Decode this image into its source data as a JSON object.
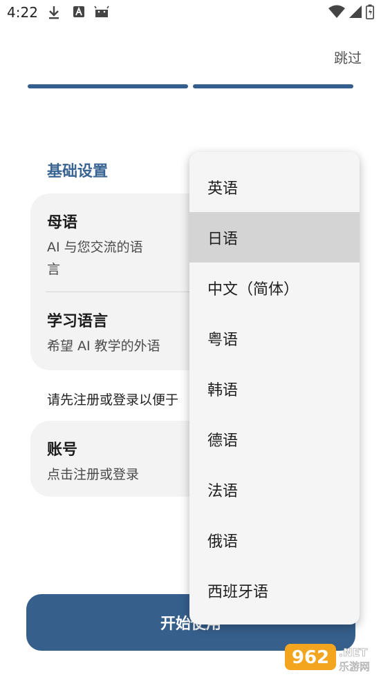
{
  "status_bar": {
    "time": "4:22"
  },
  "header": {
    "skip": "跳过"
  },
  "settings": {
    "section_title": "基础设置",
    "native_language": {
      "title": "母语",
      "subtitle_line1": "AI 与您交流的语",
      "subtitle_line2": "言"
    },
    "study_language": {
      "title": "学习语言",
      "subtitle": "希望 AI 教学的外语"
    },
    "notice": "请先注册或登录以便于",
    "account": {
      "title": "账号",
      "subtitle": "点击注册或登录"
    }
  },
  "start_button": {
    "label": "开始使用"
  },
  "menu": {
    "items": [
      "英语",
      "日语",
      "中文（简体）",
      "粤语",
      "韩语",
      "德语",
      "法语",
      "俄语",
      "西班牙语"
    ],
    "selected": "日语"
  },
  "watermark": {
    "text1": "962",
    "text2": ".NET",
    "text3": "乐游网"
  },
  "colors": {
    "accent": "#365f8c",
    "section_title": "#3a6592",
    "card_bg": "#f3f3f3",
    "menu_bg": "#f5f5f5",
    "menu_selected_bg": "#d4d4d4"
  }
}
